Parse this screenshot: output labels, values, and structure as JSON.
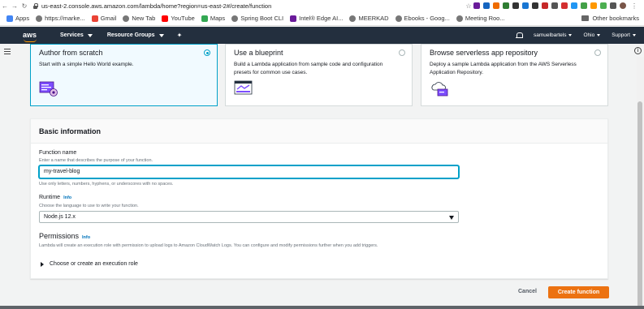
{
  "browser": {
    "url": "us-east-2.console.aws.amazon.com/lambda/home?region=us-east-2#/create/function",
    "bookmarks": [
      "Apps",
      "https://marke...",
      "Gmail",
      "New Tab",
      "YouTube",
      "Maps",
      "Spring Boot CLI",
      "Intel® Edge AI...",
      "MEERKAD",
      "Ebooks - Goog...",
      "Meeting Roo..."
    ],
    "other_bookmarks": "Other bookmarks"
  },
  "nav": {
    "logo": "aws",
    "services": "Services",
    "resource_groups": "Resource Groups",
    "pin_icon": "pin-icon",
    "user": "samuelbartels",
    "region": "Ohio",
    "support": "Support"
  },
  "options": [
    {
      "title": "Author from scratch",
      "desc": "Start with a simple Hello World example.",
      "selected": true
    },
    {
      "title": "Use a blueprint",
      "desc": "Build a Lambda application from sample code and configuration presets for common use cases.",
      "selected": false
    },
    {
      "title": "Browse serverless app repository",
      "desc": "Deploy a sample Lambda application from the AWS Serverless Application Repository.",
      "selected": false
    }
  ],
  "basic": {
    "title": "Basic information",
    "function_name_label": "Function name",
    "function_name_hint": "Enter a name that describes the purpose of your function.",
    "function_name_value": "my-travel-blog",
    "function_name_rule": "Use only letters, numbers, hyphens, or underscores with no spaces.",
    "runtime_label": "Runtime",
    "runtime_info": "Info",
    "runtime_hint": "Choose the language to use to write your function.",
    "runtime_value": "Node.js 12.x",
    "permissions_title": "Permissions",
    "permissions_info": "Info",
    "permissions_desc": "Lambda will create an execution role with permission to upload logs to Amazon CloudWatch Logs. You can configure and modify permissions further when you add triggers.",
    "role_expander": "Choose or create an execution role"
  },
  "actions": {
    "cancel": "Cancel",
    "create": "Create function"
  },
  "colors": {
    "nav_bg": "#232f3e",
    "accent": "#00a1c9",
    "primary": "#ec7211"
  }
}
